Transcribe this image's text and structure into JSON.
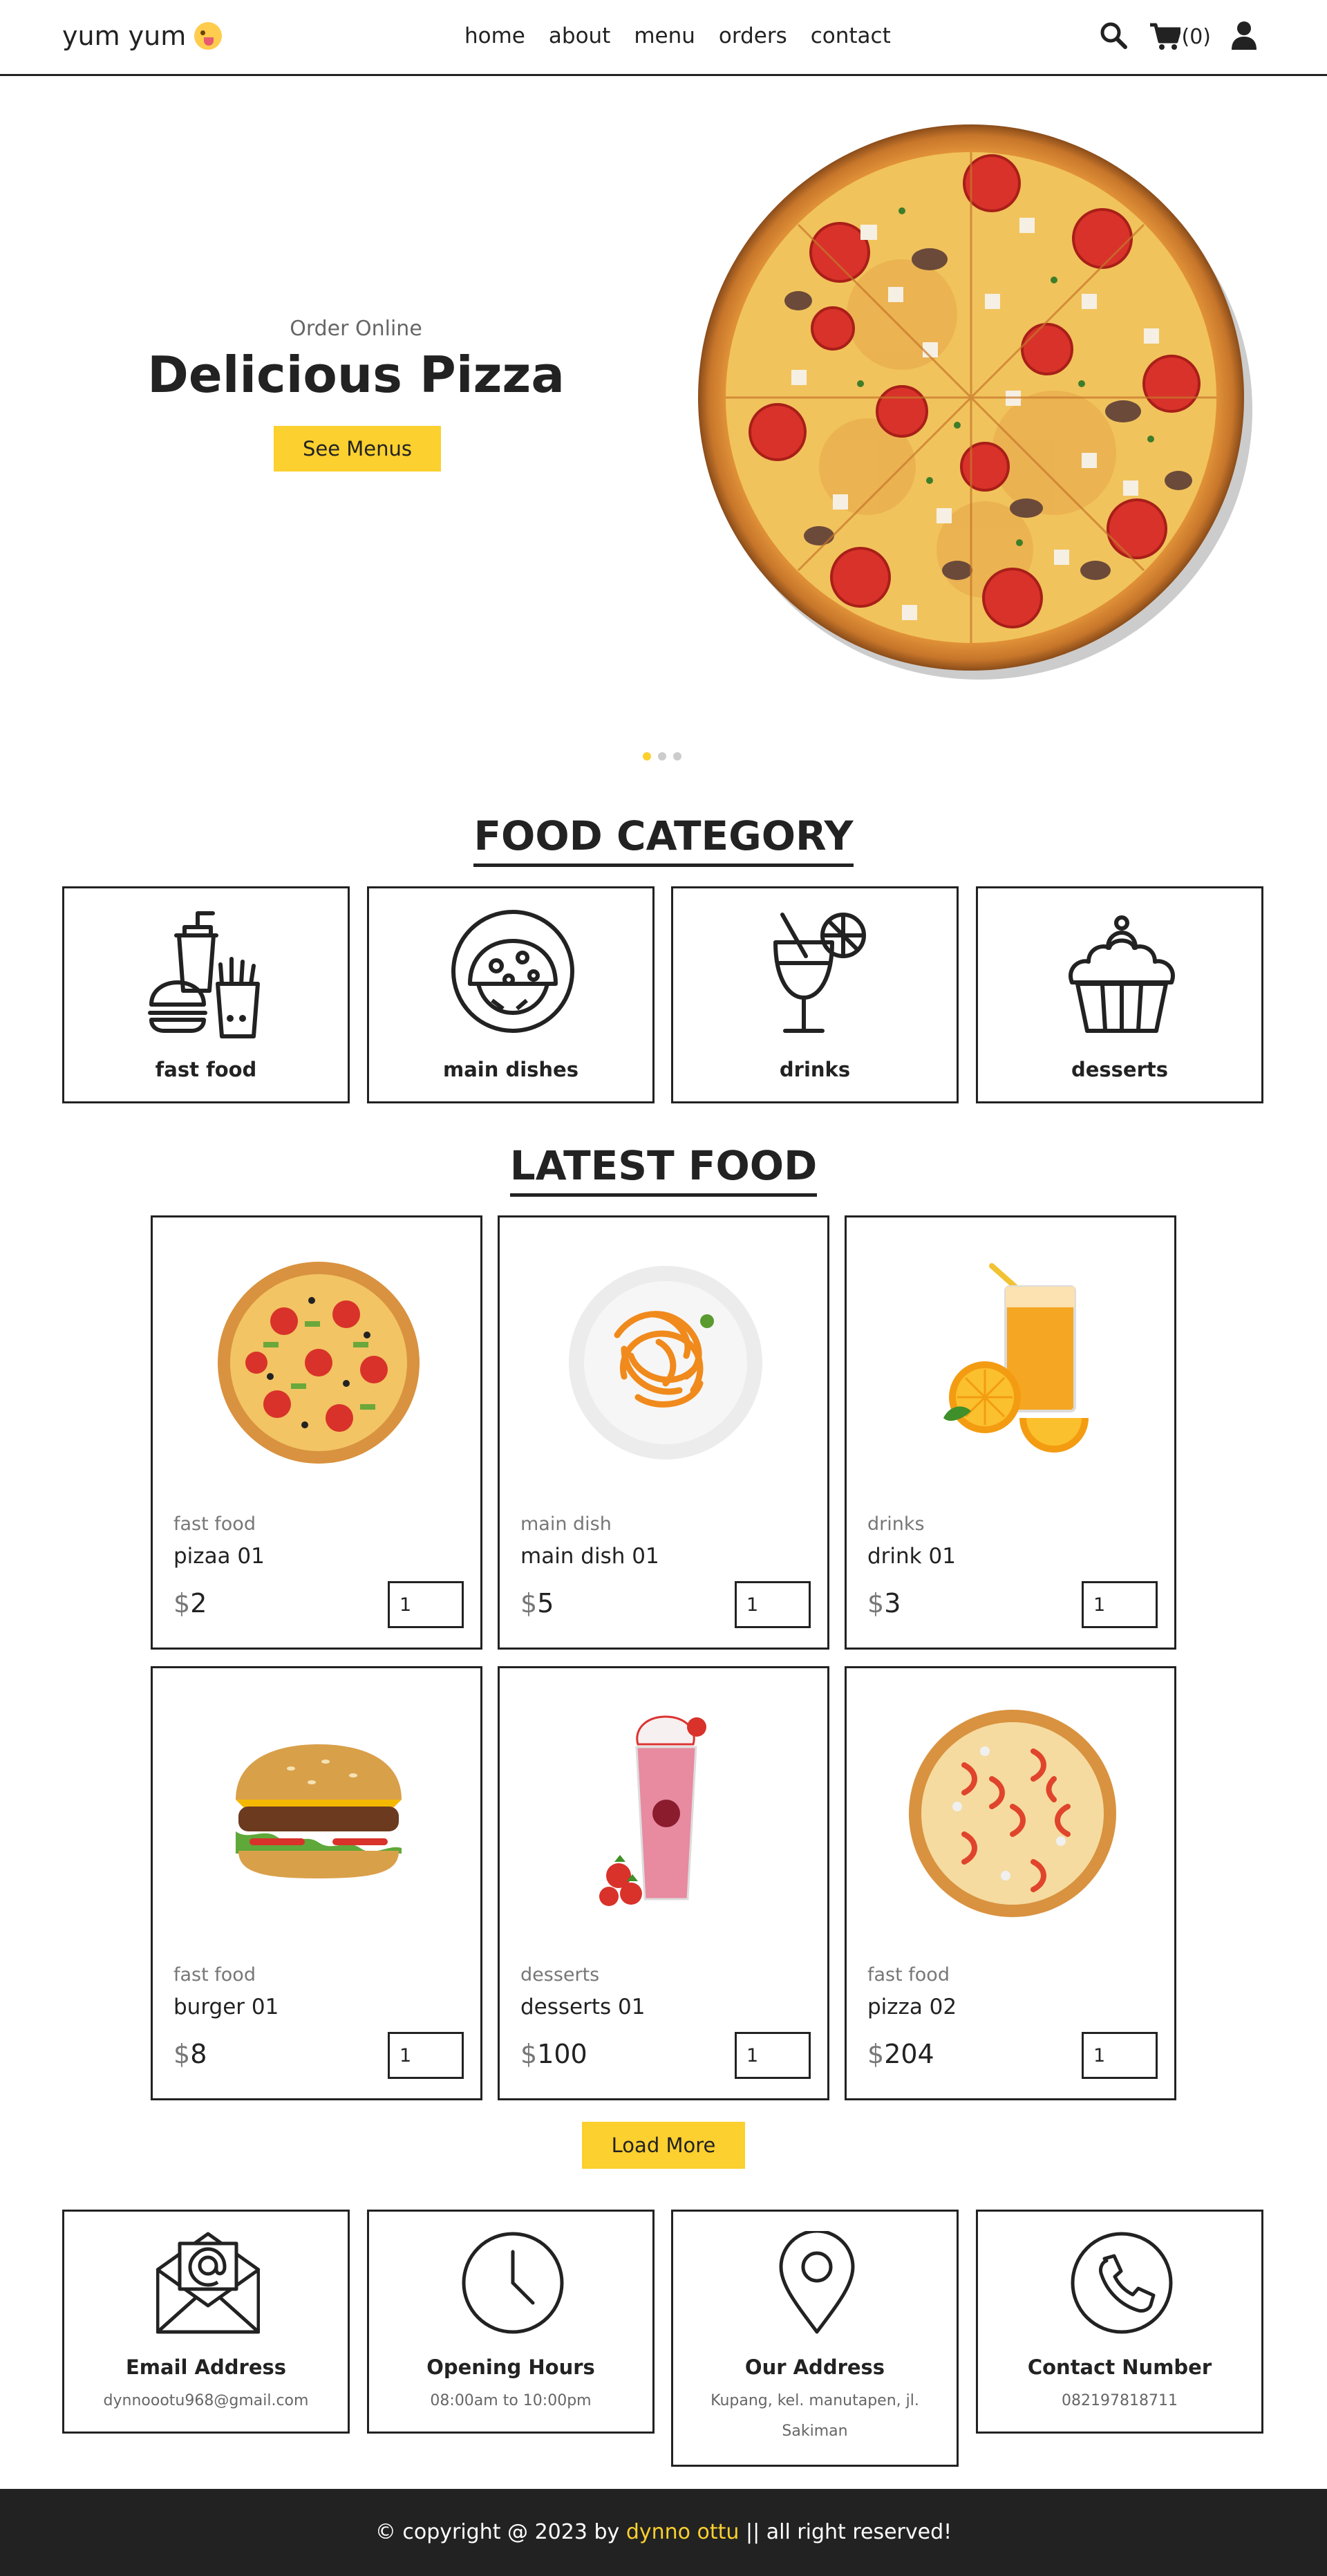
{
  "header": {
    "logo": "yum yum",
    "nav": [
      "home",
      "about",
      "menu",
      "orders",
      "contact"
    ],
    "cart_count": "(0)",
    "icons": [
      "search-icon",
      "cart-icon",
      "user-icon"
    ]
  },
  "hero": {
    "subtitle": "Order Online",
    "title": "Delicious Pizza",
    "button": "See Menus",
    "slides": 3,
    "active_slide": 1
  },
  "categories": {
    "title": "FOOD CATEGORY",
    "items": [
      {
        "label": "fast food",
        "icon": "fast-food-icon"
      },
      {
        "label": "main dishes",
        "icon": "main-dish-icon"
      },
      {
        "label": "drinks",
        "icon": "drink-icon"
      },
      {
        "label": "desserts",
        "icon": "dessert-icon"
      }
    ]
  },
  "latest": {
    "title": "LATEST FOOD",
    "currency": "$",
    "items": [
      {
        "category": "fast food",
        "name": "pizaa 01",
        "price": "2",
        "qty": "1"
      },
      {
        "category": "main dish",
        "name": "main dish 01",
        "price": "5",
        "qty": "1"
      },
      {
        "category": "drinks",
        "name": "drink 01",
        "price": "3",
        "qty": "1"
      },
      {
        "category": "fast food",
        "name": "burger 01",
        "price": "8",
        "qty": "1"
      },
      {
        "category": "desserts",
        "name": "desserts 01",
        "price": "100",
        "qty": "1"
      },
      {
        "category": "fast food",
        "name": "pizza 02",
        "price": "204",
        "qty": "1"
      }
    ],
    "load_more": "Load More"
  },
  "info": [
    {
      "title": "Email Address",
      "text": "dynnoootu968@gmail.com",
      "icon": "email-icon"
    },
    {
      "title": "Opening Hours",
      "text": "08:00am to 10:00pm",
      "icon": "clock-icon"
    },
    {
      "title": "Our Address",
      "text": "Kupang, kel. manutapen, jl. Sakiman",
      "icon": "location-pin-icon"
    },
    {
      "title": "Contact Number",
      "text": "082197818711",
      "icon": "phone-icon"
    }
  ],
  "footer": {
    "prefix": "© copyright @ 2023 by",
    "author": "dynno ottu",
    "suffix": "|| all right reserved!"
  },
  "colors": {
    "accent": "#fbd02f",
    "dark": "#222222",
    "muted": "#777777"
  }
}
